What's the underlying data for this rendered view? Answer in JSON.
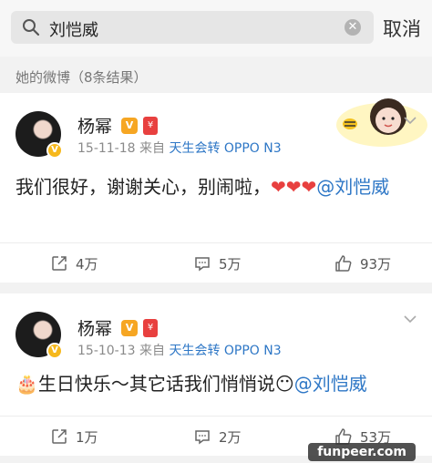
{
  "search": {
    "query": "刘恺威",
    "cancel_label": "取消"
  },
  "section": {
    "title": "她的微博（8条结果）"
  },
  "posts": [
    {
      "username": "杨幂",
      "date": "15-11-18",
      "via": "来自",
      "source": "天生会转 OPPO N3",
      "text_before": "我们很好，谢谢关心，别闹啦，",
      "emoji": "❤❤❤",
      "mention": "@刘恺威",
      "share_count": "4万",
      "comment_count": "5万",
      "like_count": "93万"
    },
    {
      "username": "杨幂",
      "date": "15-10-13",
      "via": "来自",
      "source": "天生会转 OPPO N3",
      "emoji_lead": "🎂",
      "text_before": "生日快乐～其它话我们悄悄说",
      "emoji": "😶",
      "mention": "@刘恺威",
      "share_count": "1万",
      "comment_count": "2万",
      "like_count": "53万"
    }
  ],
  "watermark": "funpeer.com",
  "colors": {
    "link": "#2e77c6",
    "heart": "#e8403f",
    "badge_gold": "#f6a623"
  },
  "icons": [
    "search-icon",
    "clear-icon",
    "chevron-down-icon",
    "share-icon",
    "comment-icon",
    "like-icon",
    "verified-icon"
  ]
}
